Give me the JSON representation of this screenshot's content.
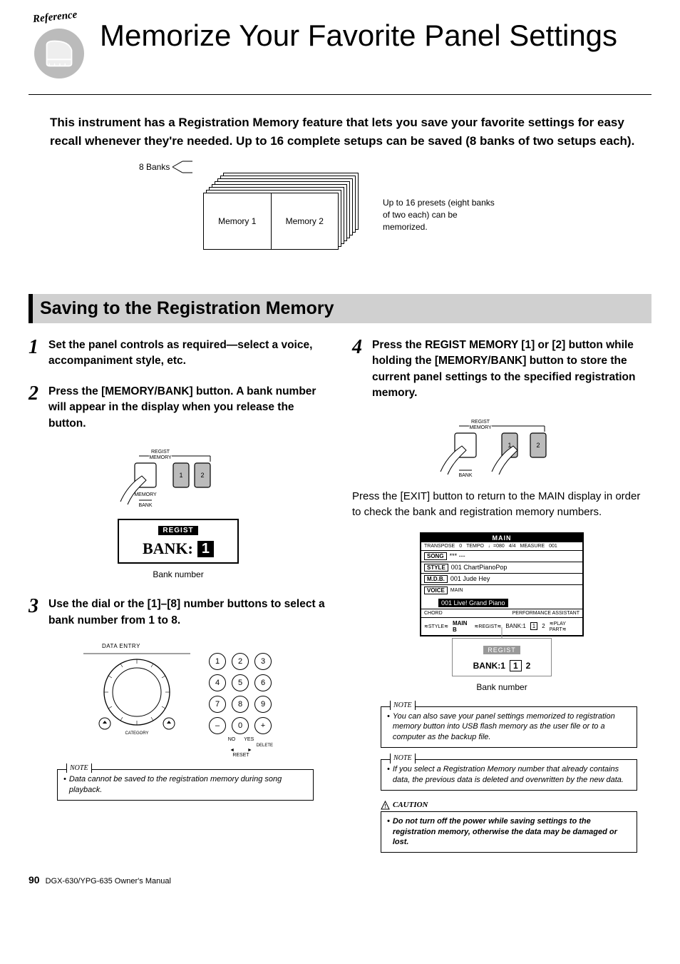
{
  "header": {
    "reference_label": "Reference",
    "title": "Memorize Your Favorite Panel Settings"
  },
  "intro": "This instrument has a Registration Memory feature that lets you save your favorite settings for easy recall whenever they're needed. Up to 16 complete setups can be saved (8 banks of two setups each).",
  "banks_diagram": {
    "label": "8 Banks",
    "memory1": "Memory 1",
    "memory2": "Memory 2",
    "caption": "Up to 16 presets (eight banks of two each) can be memorized."
  },
  "section_title": "Saving to the Registration Memory",
  "steps": {
    "s1": "Set the panel controls as required—select a voice, accompaniment style, etc.",
    "s2": "Press the [MEMORY/BANK] button. A bank number will appear in the display when you release the button.",
    "s3": "Use the dial or the [1]–[8] number buttons to select a bank number from 1 to 8.",
    "s4": "Press the REGIST MEMORY [1] or [2] button while holding the [MEMORY/BANK] button to store the current panel settings to the specified registration memory."
  },
  "lcd": {
    "regist_label": "REGIST",
    "bank_label": "BANK:",
    "bank_value": "1",
    "caption": "Bank number"
  },
  "dial": {
    "data_entry": "DATA ENTRY",
    "keys": [
      "1",
      "2",
      "3",
      "4",
      "5",
      "6",
      "7",
      "8",
      "9",
      "–",
      "0",
      "+"
    ],
    "no": "NO",
    "yes": "YES",
    "delete": "DELETE",
    "reset": "RESET",
    "category": "CATEGORY"
  },
  "note_left": "Data cannot be saved to the registration memory during song playback.",
  "note_tab": "NOTE",
  "button_labels": {
    "regist_memory": "REGIST\nMEMORY",
    "memory": "MEMORY",
    "bank": "BANK",
    "one": "1",
    "two": "2"
  },
  "body_right": "Press the [EXIT] button to return to the MAIN display in order to check the bank and registration memory numbers.",
  "main_display": {
    "title": "MAIN",
    "status": {
      "transpose_l": "TRANSPOSE",
      "transpose_v": "0",
      "tempo_l": "TEMPO",
      "tempo_v": "♩=080",
      "ts": "4/4",
      "measure_l": "MEASURE",
      "measure_v": "001"
    },
    "song": {
      "chip": "SONG",
      "val": "*** ---"
    },
    "style": {
      "chip": "STYLE",
      "val": "001 ChartPianoPop"
    },
    "mdb": {
      "chip": "M.D.B.",
      "val": "001 Jude Hey"
    },
    "voice": {
      "chip": "VOICE",
      "sub": "MAIN",
      "val": "001 Live! Grand Piano"
    },
    "chord": "CHORD",
    "perf_assist": "PERFORMANCE ASSISTANT",
    "bottom": {
      "style_sec": "STYLE",
      "mainb": "MAIN B",
      "regist_sec": "REGIST",
      "bank": "BANK:1",
      "play": "PLAY PART"
    }
  },
  "regist_callout": {
    "title": "REGIST",
    "bank": "BANK:1",
    "n1": "1",
    "n2": "2",
    "caption": "Bank number"
  },
  "note_r1": "You can also save your panel settings memorized to registration memory button into USB flash memory as the user file or to a computer as the backup file.",
  "note_r2": "If you select a Registration Memory number that already contains data, the previous data is deleted and overwritten by the new data.",
  "caution_label": "CAUTION",
  "caution_text": "Do not turn off the power while saving settings to the registration memory, otherwise the data may be damaged or lost.",
  "footer": {
    "page": "90",
    "manual": "DGX-630/YPG-635  Owner's Manual"
  }
}
